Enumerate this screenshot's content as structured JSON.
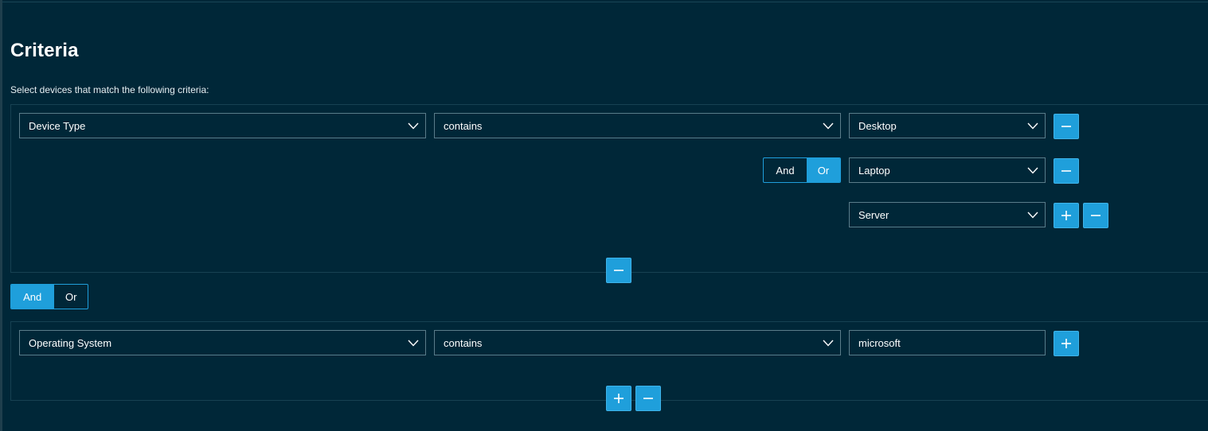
{
  "page": {
    "title": "Criteria",
    "subtitle": "Select devices that match the following criteria:"
  },
  "groups": [
    {
      "field": "Device Type",
      "operator": "contains",
      "values": [
        "Desktop",
        "Laptop",
        "Server"
      ],
      "value_logic": {
        "and_label": "And",
        "or_label": "Or",
        "selected": "Or"
      }
    },
    {
      "field": "Operating System",
      "operator": "contains",
      "value": "microsoft"
    }
  ],
  "group_logic": {
    "and_label": "And",
    "or_label": "Or",
    "selected": "And"
  },
  "icons": {
    "add": "plus-icon",
    "remove": "minus-icon",
    "dropdown": "chevron-down-icon"
  },
  "colors": {
    "background": "#002738",
    "accent": "#1f9fdb",
    "border": "#5a7c8a"
  }
}
